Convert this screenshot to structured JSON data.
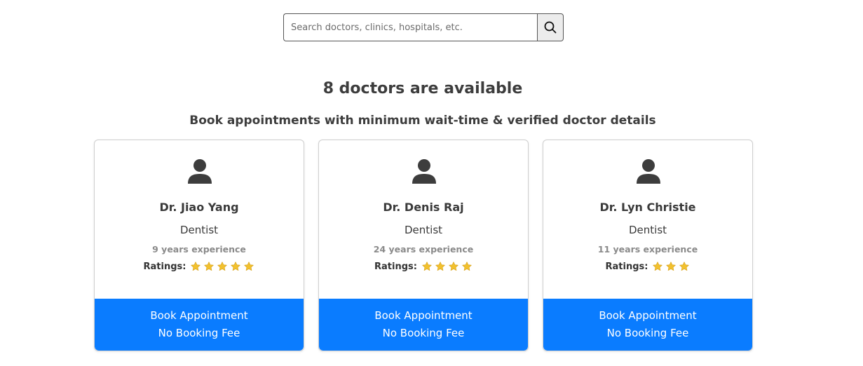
{
  "search": {
    "placeholder": "Search doctors, clinics, hospitals, etc.",
    "button_icon": "search-icon"
  },
  "headings": {
    "count": "8 doctors are available",
    "subtitle": "Book appointments with minimum wait-time & verified doctor details"
  },
  "colors": {
    "primary": "#0a7cff",
    "star": "#f2c12e",
    "text": "#3a3a3a",
    "muted": "#8a8a8a"
  },
  "doctors": [
    {
      "name": "Dr. Jiao Yang",
      "specialty": "Dentist",
      "experience": "9 years experience",
      "ratings_label": "Ratings:",
      "rating": 5,
      "avatar_icon": "user-icon",
      "button_line1": "Book Appointment",
      "button_line2": "No Booking Fee"
    },
    {
      "name": "Dr. Denis Raj",
      "specialty": "Dentist",
      "experience": "24 years experience",
      "ratings_label": "Ratings:",
      "rating": 4,
      "avatar_icon": "user-icon",
      "button_line1": "Book Appointment",
      "button_line2": "No Booking Fee"
    },
    {
      "name": "Dr. Lyn Christie",
      "specialty": "Dentist",
      "experience": "11 years experience",
      "ratings_label": "Ratings:",
      "rating": 3,
      "avatar_icon": "user-icon",
      "button_line1": "Book Appointment",
      "button_line2": "No Booking Fee"
    }
  ]
}
